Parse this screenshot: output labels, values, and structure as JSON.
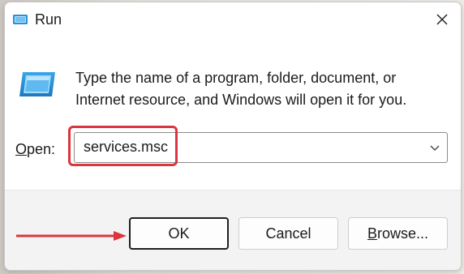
{
  "window": {
    "title": "Run",
    "title_icon": "run-icon",
    "close_icon": "close-icon"
  },
  "content": {
    "message": "Type the name of a program, folder, document, or Internet resource, and Windows will open it for you.",
    "open_label": "Open:",
    "open_value": "services.msc"
  },
  "buttons": {
    "ok": "OK",
    "cancel": "Cancel",
    "browse_prefix": "B",
    "browse_rest": "rowse..."
  },
  "colors": {
    "highlight": "#d9363e",
    "arrow": "#d9363e"
  }
}
